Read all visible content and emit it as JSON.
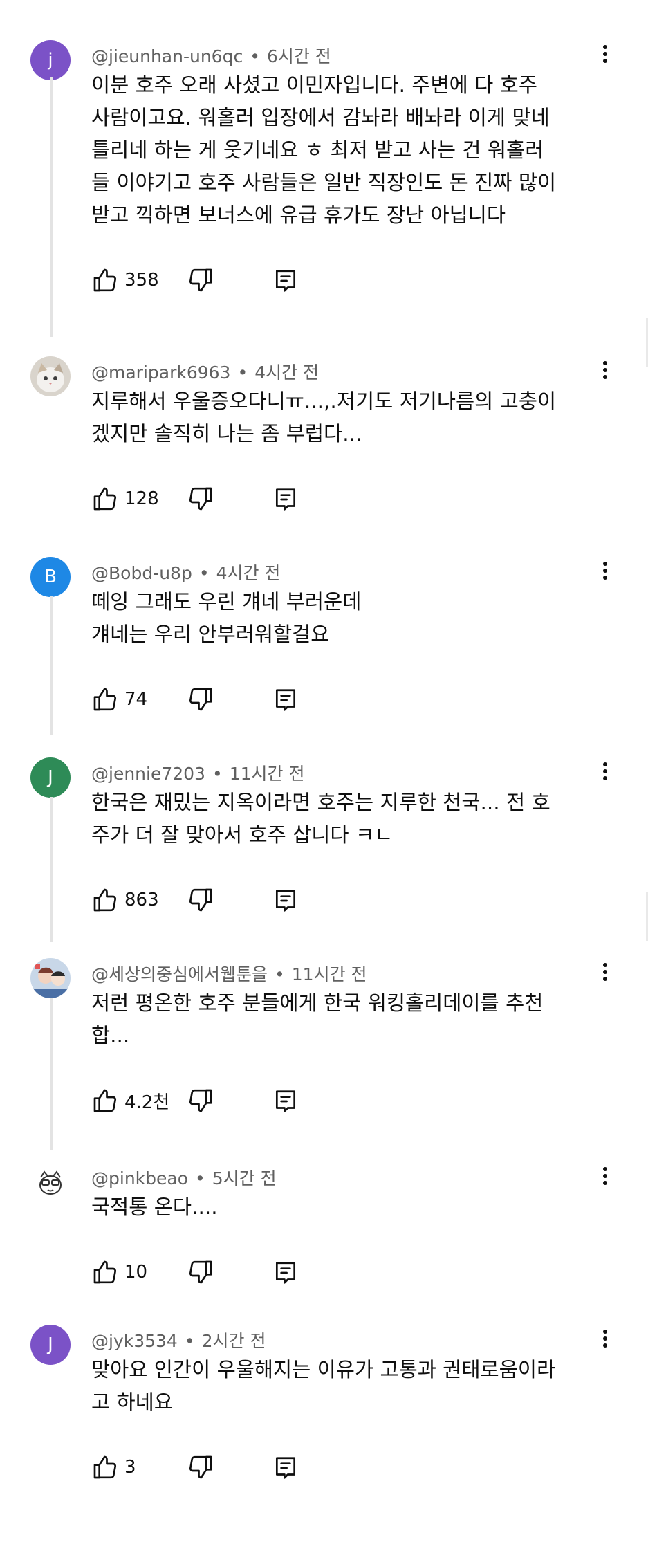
{
  "comments": [
    {
      "handle": "@jieunhan-un6qc",
      "time": "6시간 전",
      "avatar_letter": "j",
      "avatar_color": "#7b52c7",
      "lines": [
        "이분 호주 오래 사셨고 이민자입니다. 주변에 다 호주",
        "사람이고요. 워홀러 입장에서 감놔라 배놔라 이게 맞네",
        "틀리네 하는 게 웃기네요 ㅎ 최저 받고 사는 건 워홀러",
        "들 이야기고 호주 사람들은 일반 직장인도 돈 진짜 많이",
        "받고 끽하면 보너스에 유급 휴가도 장난 아닙니다"
      ],
      "likes": "358"
    },
    {
      "handle": "@maripark6963",
      "time": "4시간 전",
      "avatar_icon": "cat-photo-avatar",
      "lines": [
        "지루해서 우울증오다니ㅠ...,.저기도 저기나름의 고충이",
        "겠지만 솔직히 나는 좀 부럽다..."
      ],
      "likes": "128"
    },
    {
      "handle": "@Bobd-u8p",
      "time": "4시간 전",
      "avatar_letter": "B",
      "avatar_color": "#1e88e5",
      "lines": [
        "떼잉 그래도 우린 걔네 부러운데",
        "걔네는 우리 안부러워할걸요"
      ],
      "likes": "74"
    },
    {
      "handle": "@jennie7203",
      "time": "11시간 전",
      "avatar_letter": "J",
      "avatar_color": "#2e8b57",
      "lines": [
        "한국은 재밌는 지옥이라면 호주는 지루한 천국...  전 호",
        "주가 더 잘 맞아서 호주 삽니다 ㅋㄴ"
      ],
      "likes": "863"
    },
    {
      "handle": "@세상의중심에서웹툰을",
      "time": "11시간 전",
      "avatar_icon": "cartoon-avatar",
      "lines": [
        "저런 평온한 호주 분들에게 한국 워킹홀리데이를 추천",
        "합..."
      ],
      "likes": "4.2천"
    },
    {
      "handle": "@pinkbeao",
      "time": "5시간 전",
      "avatar_icon": "doodle-avatar",
      "lines": [
        "국적통 온다...."
      ],
      "likes": "10"
    },
    {
      "handle": "@jyk3534",
      "time": "2시간 전",
      "avatar_letter": "J",
      "avatar_color": "#7b52c7",
      "lines": [
        "맞아요 인간이 우울해지는 이유가 고통과 권태로움이라",
        "고 하네요"
      ],
      "likes": "3"
    }
  ]
}
